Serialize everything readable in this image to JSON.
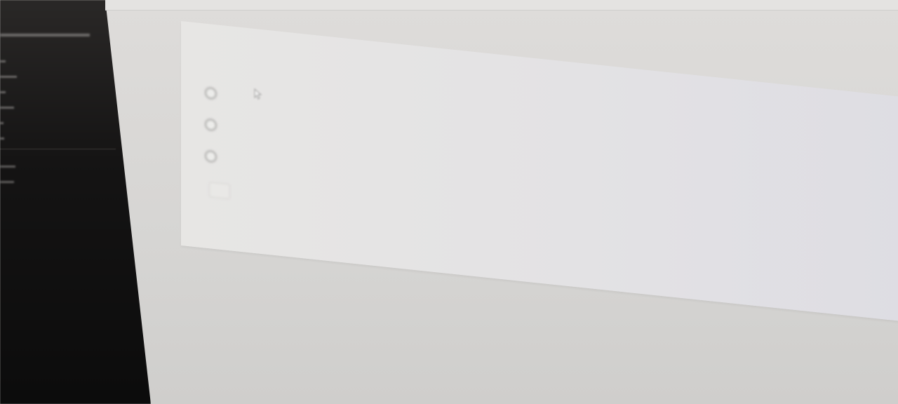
{
  "question": {
    "title": "",
    "status": "",
    "prompt": "",
    "options": [
      {
        "label": ""
      },
      {
        "label": ""
      },
      {
        "label": ""
      }
    ],
    "submit_label": ""
  },
  "sidebar": {
    "items": [
      {
        "label": ""
      },
      {
        "label": ""
      },
      {
        "label": ""
      },
      {
        "label": ""
      },
      {
        "label": ""
      },
      {
        "label": ""
      }
    ],
    "items_2": [
      {
        "label": ""
      },
      {
        "label": ""
      }
    ]
  },
  "colors": {
    "status_accent": "#f0a070",
    "sidebar_bg": "#151414",
    "card_bg": "#e5e4e4"
  }
}
